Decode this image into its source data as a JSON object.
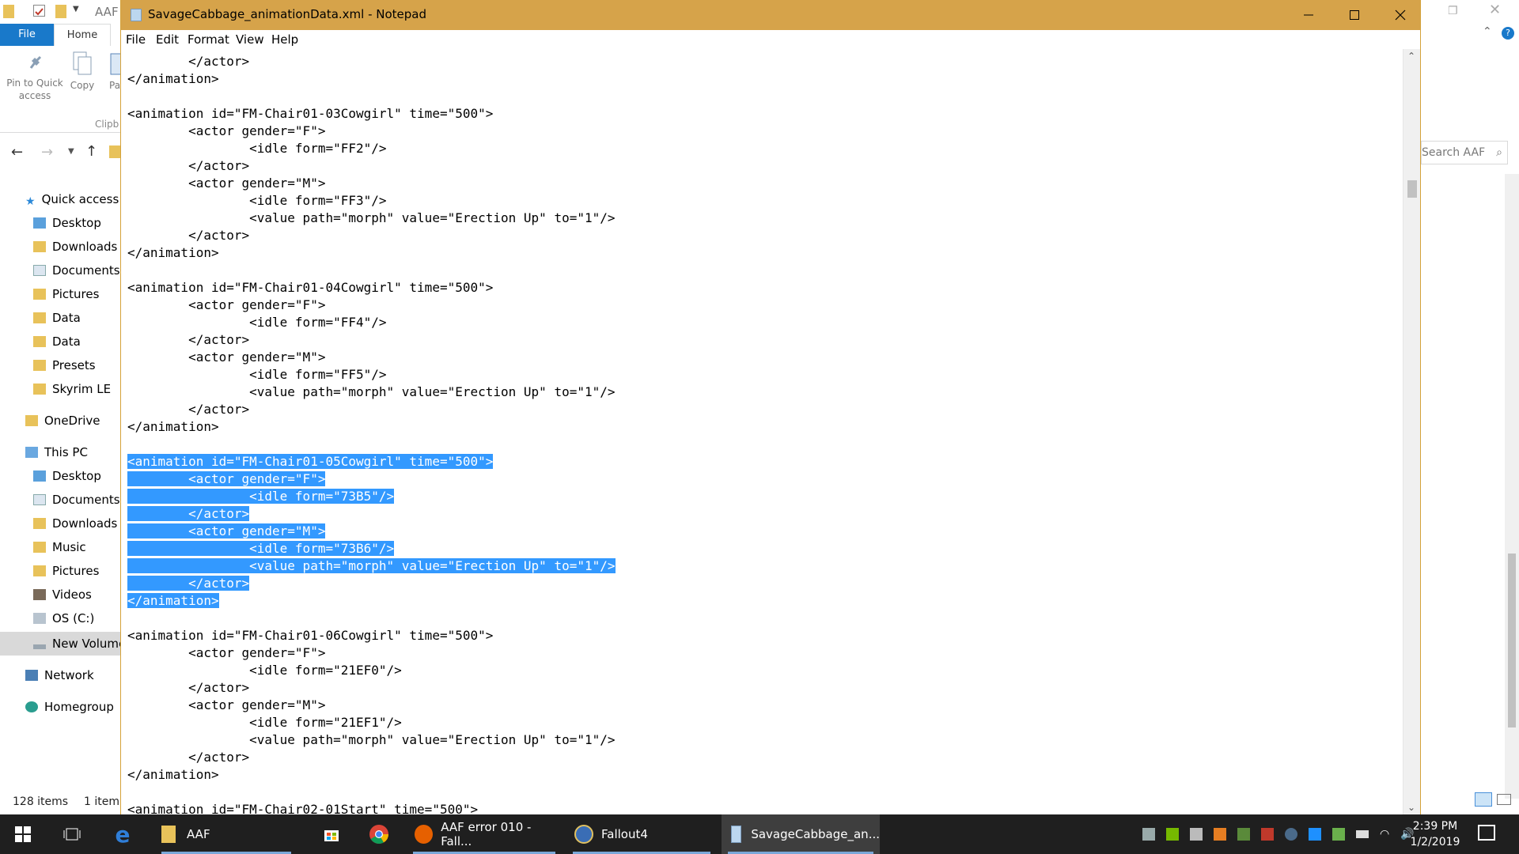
{
  "explorer": {
    "title": "AAF",
    "ribbon_tabs": [
      "File",
      "Home"
    ],
    "ribbon_buttons": {
      "pin": "Pin to Quick access",
      "copy": "Copy",
      "paste_partial": "Pa"
    },
    "ribbon_group": "Clipb",
    "search_placeholder": "Search AAF",
    "nav": {
      "quick_access": "Quick access",
      "quick_items": [
        "Desktop",
        "Downloads",
        "Documents",
        "Pictures",
        "Data",
        "Data",
        "Presets",
        "Skyrim LE"
      ],
      "onedrive": "OneDrive",
      "this_pc": "This PC",
      "pc_items": [
        "Desktop",
        "Documents",
        "Downloads",
        "Music",
        "Pictures",
        "Videos",
        "OS (C:)",
        "New Volume"
      ],
      "network": "Network",
      "homegroup": "Homegroup"
    },
    "status": {
      "items": "128 items",
      "selected": "1 item"
    }
  },
  "notepad": {
    "title": "SavageCabbage_animationData.xml - Notepad",
    "menu": [
      "File",
      "Edit",
      "Format",
      "View",
      "Help"
    ],
    "lines": [
      "        </actor>",
      "</animation>",
      "",
      "<animation id=\"FM-Chair01-03Cowgirl\" time=\"500\">",
      "        <actor gender=\"F\">",
      "                <idle form=\"FF2\"/>",
      "        </actor>",
      "        <actor gender=\"M\">",
      "                <idle form=\"FF3\"/>",
      "                <value path=\"morph\" value=\"Erection Up\" to=\"1\"/>",
      "        </actor>",
      "</animation>",
      "",
      "<animation id=\"FM-Chair01-04Cowgirl\" time=\"500\">",
      "        <actor gender=\"F\">",
      "                <idle form=\"FF4\"/>",
      "        </actor>",
      "        <actor gender=\"M\">",
      "                <idle form=\"FF5\"/>",
      "                <value path=\"morph\" value=\"Erection Up\" to=\"1\"/>",
      "        </actor>",
      "</animation>",
      "",
      "<animation id=\"FM-Chair01-05Cowgirl\" time=\"500\">",
      "        <actor gender=\"F\">",
      "                <idle form=\"73B5\"/>",
      "        </actor>",
      "        <actor gender=\"M\">",
      "                <idle form=\"73B6\"/>",
      "                <value path=\"morph\" value=\"Erection Up\" to=\"1\"/>",
      "        </actor>",
      "</animation>",
      "",
      "<animation id=\"FM-Chair01-06Cowgirl\" time=\"500\">",
      "        <actor gender=\"F\">",
      "                <idle form=\"21EF0\"/>",
      "        </actor>",
      "        <actor gender=\"M\">",
      "                <idle form=\"21EF1\"/>",
      "                <value path=\"morph\" value=\"Erection Up\" to=\"1\"/>",
      "        </actor>",
      "</animation>",
      "",
      "<animation id=\"FM-Chair02-01Start\" time=\"500\">"
    ],
    "selected_lines": [
      23,
      24,
      25,
      26,
      27,
      28,
      29,
      30,
      31
    ]
  },
  "taskbar": {
    "items": [
      {
        "name": "explorer",
        "label": "AAF"
      },
      {
        "name": "firefox",
        "label": "AAF error 010 - Fall..."
      },
      {
        "name": "fallout4",
        "label": "Fallout4"
      },
      {
        "name": "notepad",
        "label": "SavageCabbage_an..."
      }
    ],
    "time": "2:39 PM",
    "date": "1/2/2019"
  },
  "colors": {
    "notepad_titlebar": "#d6a34a",
    "selection": "#3399ff",
    "taskbar": "#1f1f1f",
    "accent": "#1979ca"
  }
}
